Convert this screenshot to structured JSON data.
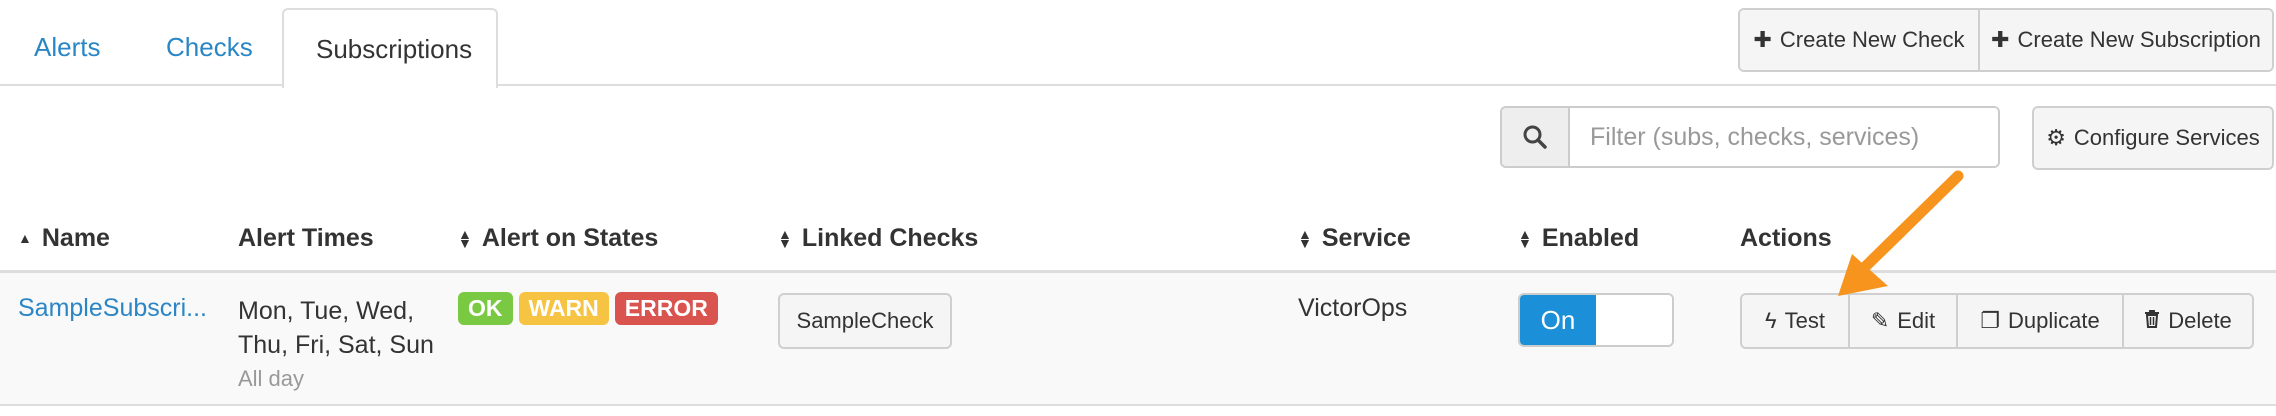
{
  "tabs": [
    {
      "label": "Alerts",
      "active": false
    },
    {
      "label": "Checks",
      "active": false
    },
    {
      "label": "Subscriptions",
      "active": true
    }
  ],
  "toolbar": {
    "create_check": "Create New Check",
    "create_subscription": "Create New Subscription",
    "configure_services": "Configure Services"
  },
  "search": {
    "placeholder": "Filter (subs, checks, services)",
    "value": ""
  },
  "table": {
    "headers": {
      "name": "Name",
      "alert_times": "Alert Times",
      "alert_states": "Alert on States",
      "linked_checks": "Linked Checks",
      "service": "Service",
      "enabled": "Enabled",
      "actions": "Actions"
    },
    "rows": [
      {
        "name": "SampleSubscri...",
        "alert_days_line1": "Mon, Tue, Wed,",
        "alert_days_line2": "Thu, Fri, Sat, Sun",
        "alert_hours": "All day",
        "states": [
          "OK",
          "WARN",
          "ERROR"
        ],
        "linked_check": "SampleCheck",
        "service": "VictorOps",
        "enabled_label": "On",
        "enabled": true
      }
    ]
  },
  "actions": {
    "test": "Test",
    "edit": "Edit",
    "duplicate": "Duplicate",
    "delete": "Delete"
  },
  "colors": {
    "link": "#2a86c5",
    "ok": "#7ac943",
    "warn": "#f6c342",
    "error": "#d9534f",
    "toggle_on": "#1b8fd8",
    "annotation_arrow": "#f7941d"
  },
  "icons": {
    "plus": "plus-icon",
    "gear": "gear-icon",
    "search": "search-icon",
    "sort": "sort-icon",
    "bolt": "bolt-icon",
    "pencil": "pencil-icon",
    "copy": "copy-icon",
    "trash": "trash-icon"
  }
}
